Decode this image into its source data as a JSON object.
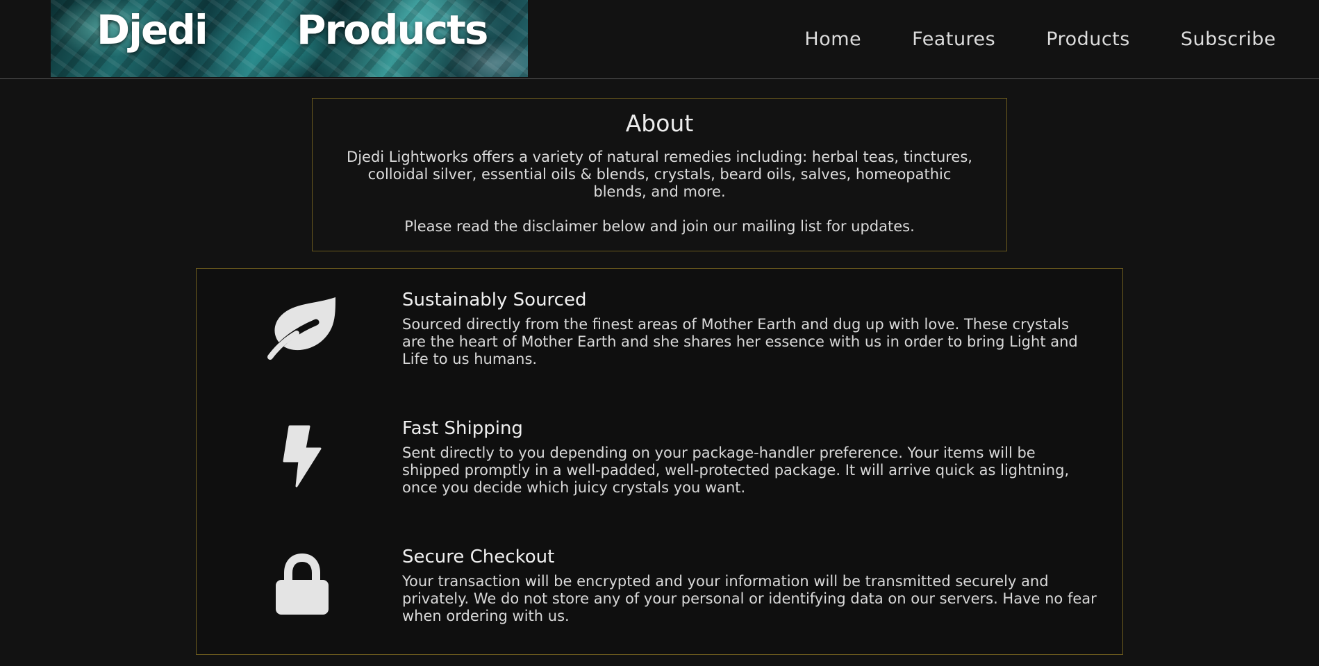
{
  "header": {
    "logo_word_1": "Djedi",
    "logo_word_2": "Products",
    "nav": [
      "Home",
      "Features",
      "Products",
      "Subscribe"
    ]
  },
  "about": {
    "title": "About",
    "paragraph_1": "Djedi Lightworks offers a variety of natural remedies including: herbal teas, tinctures, colloidal silver, essential oils & blends, crystals, beard oils, salves, homeopathic blends, and more.",
    "paragraph_2": "Please read the disclaimer below and join our mailing list for updates."
  },
  "features": [
    {
      "icon": "leaf-icon",
      "title": "Sustainably Sourced",
      "text": "Sourced directly from the finest areas of Mother Earth and dug up with love. These crystals are the heart of Mother Earth and she shares her essence with us in order to bring Light and Life to us humans."
    },
    {
      "icon": "bolt-icon",
      "title": "Fast Shipping",
      "text": "Sent directly to you depending on your package-handler preference. Your items will be shipped promptly in a well-padded, well-protected package. It will arrive quick as lightning, once you decide which juicy crystals you want."
    },
    {
      "icon": "lock-icon",
      "title": "Secure Checkout",
      "text": "Your transaction will be encrypted and your information will be transmitted securely and privately. We do not store any of your personal or identifying data on our servers. Have no fear when ordering with us."
    }
  ],
  "colors": {
    "background": "#121212",
    "border_accent": "#6b5a1e",
    "icon": "#e4e4e4"
  }
}
